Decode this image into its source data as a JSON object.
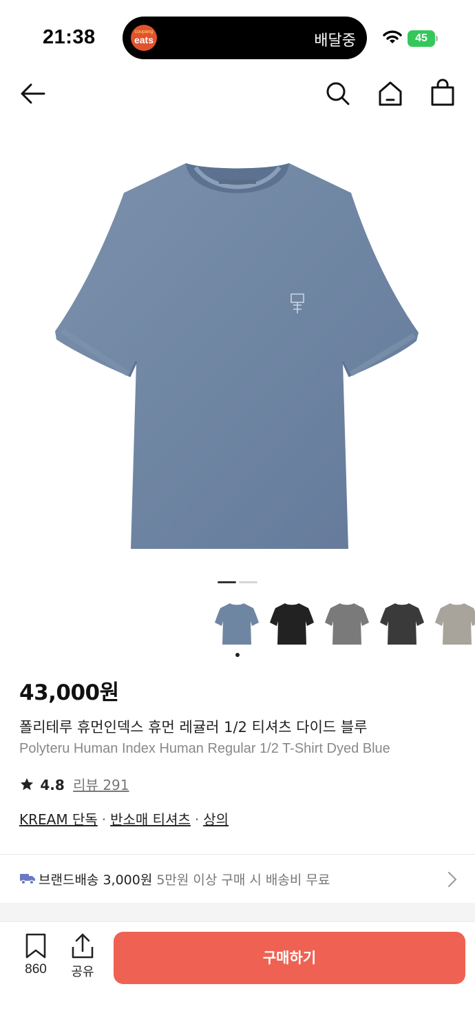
{
  "status_bar": {
    "time": "21:38",
    "app_logo_small": "coupang",
    "app_logo_big": "eats",
    "island_text": "배달중",
    "battery": "45"
  },
  "nav": {
    "icons": [
      "back-arrow-icon",
      "search-icon",
      "home-icon",
      "shopping-bag-icon"
    ]
  },
  "gallery": {
    "page_count": 2,
    "current_page": 1,
    "thumbnails": [
      {
        "color": "#6f86a3",
        "name": "blue"
      },
      {
        "color": "#222222",
        "name": "black"
      },
      {
        "color": "#7a7a7a",
        "name": "gray"
      },
      {
        "color": "#3a3a3a",
        "name": "charcoal"
      },
      {
        "color": "#a8a39b",
        "name": "beige"
      }
    ],
    "selected_thumbnail": 0
  },
  "product": {
    "price": "43,000원",
    "name_ko": "폴리테루 휴먼인덱스 휴먼 레귤러 1/2 티셔츠 다이드 블루",
    "name_en": "Polyteru Human Index Human Regular 1/2 T-Shirt Dyed Blue",
    "rating": "4.8",
    "review_label": "리뷰 291",
    "tags": [
      "KREAM 단독",
      "반소매 티셔츠",
      "상의"
    ]
  },
  "shipping": {
    "label": "브랜드배송 3,000원",
    "condition": "5만원 이상 구매 시 배송비 무료"
  },
  "bottom_bar": {
    "saved_count": "860",
    "share_label": "공유",
    "buy_label": "구매하기"
  },
  "colors": {
    "accent": "#ef6253",
    "shirt": "#6f86a3",
    "battery": "#34c759"
  }
}
